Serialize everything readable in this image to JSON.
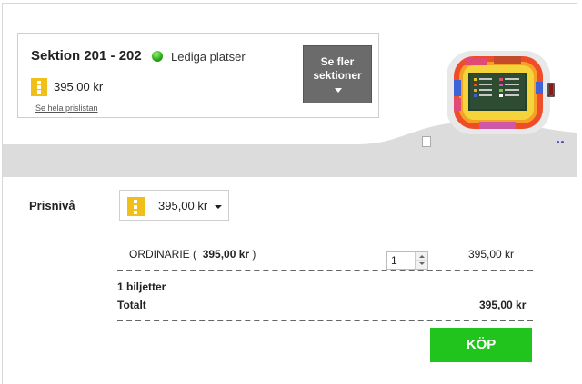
{
  "section": {
    "title": "Sektion 201 - 202",
    "availability": "Lediga platser",
    "price": "395,00 kr",
    "pricelist_link": "Se hela prislistan",
    "more_sections_button": "Se fler\nsektioner"
  },
  "price_level": {
    "label": "Prisnivå",
    "selected": "395,00 kr",
    "swatch_color": "#f0bf1a"
  },
  "order": {
    "ticket_type": "ORDINARIE (",
    "ticket_type_price": "395,00 kr",
    "ticket_type_close": ")",
    "quantity": "1",
    "line_price": "395,00 kr",
    "tickets_count": "1 biljetter",
    "total_label": "Totalt",
    "total_value": "395,00 kr"
  },
  "buy_button": "KÖP",
  "colors": {
    "buy_green": "#21c41c",
    "button_grey": "#6b6b6b",
    "availability_green": "#2eae1a"
  }
}
